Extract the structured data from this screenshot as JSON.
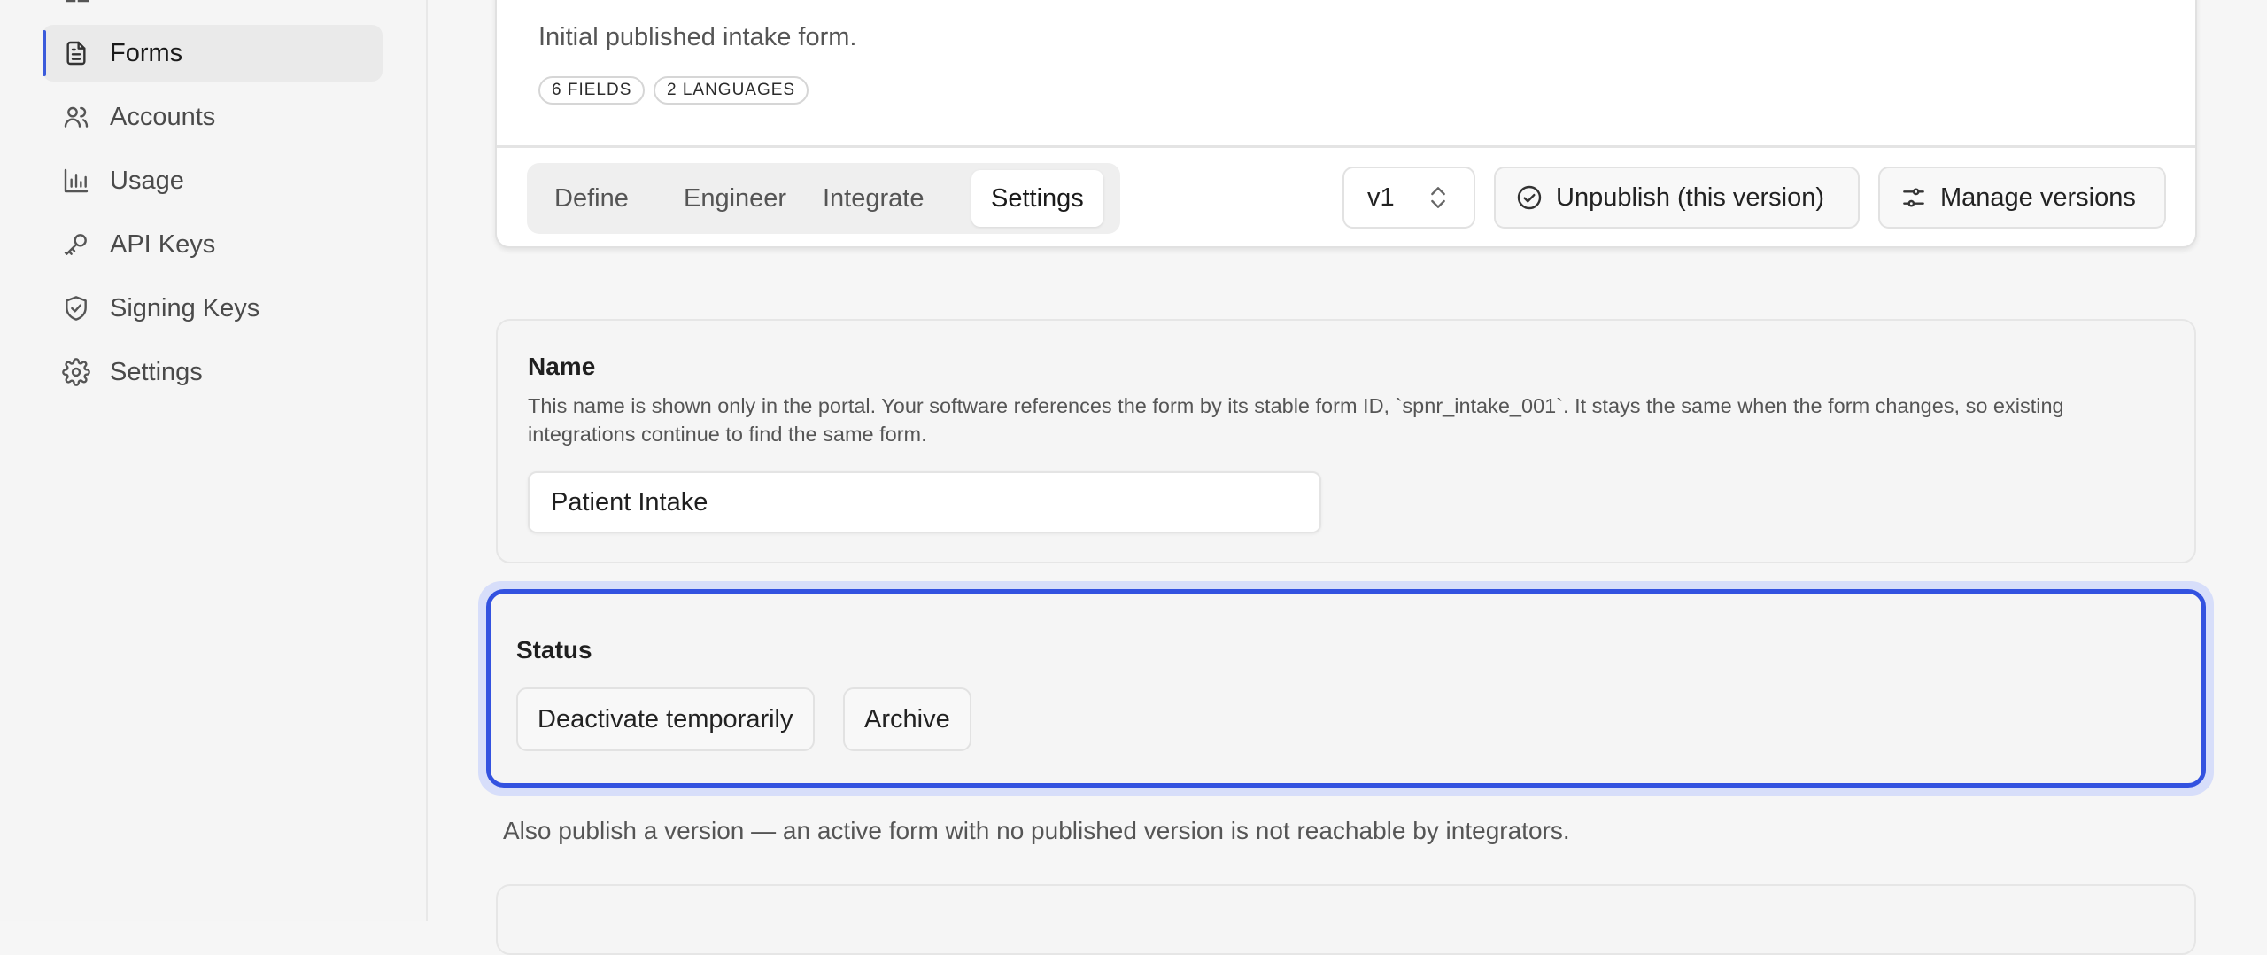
{
  "sidebar": {
    "items": [
      {
        "label": "Forms",
        "icon": "document-icon",
        "active": true
      },
      {
        "label": "Accounts",
        "icon": "users-icon",
        "active": false
      },
      {
        "label": "Usage",
        "icon": "bar-chart-icon",
        "active": false
      },
      {
        "label": "API Keys",
        "icon": "key-icon",
        "active": false
      },
      {
        "label": "Signing Keys",
        "icon": "shield-check-icon",
        "active": false
      },
      {
        "label": "Settings",
        "icon": "gear-icon",
        "active": false
      }
    ]
  },
  "header": {
    "description": "Initial published intake form.",
    "badges": [
      "6 FIELDS",
      "2 LANGUAGES"
    ],
    "tabs": [
      {
        "label": "Define",
        "active": false
      },
      {
        "label": "Engineer",
        "active": false
      },
      {
        "label": "Integrate",
        "active": false
      },
      {
        "label": "Settings",
        "active": true
      }
    ],
    "version_select": "v1",
    "unpublish_label": "Unpublish (this version)",
    "manage_versions_label": "Manage versions"
  },
  "name_section": {
    "title": "Name",
    "help": "This name is shown only in the portal. Your software references the form by its stable form ID, `spnr_intake_001`. It stays the same when the form changes, so existing integrations continue to find the same form.",
    "value": "Patient Intake"
  },
  "status_section": {
    "title": "Status",
    "deactivate_label": "Deactivate temporarily",
    "archive_label": "Archive",
    "note": "Also publish a version — an active form with no published version is not reachable by integrators."
  },
  "colors": {
    "accent": "#3352e0",
    "focus_ring": "#d7defa",
    "active_indicator": "#3b5bdb"
  }
}
